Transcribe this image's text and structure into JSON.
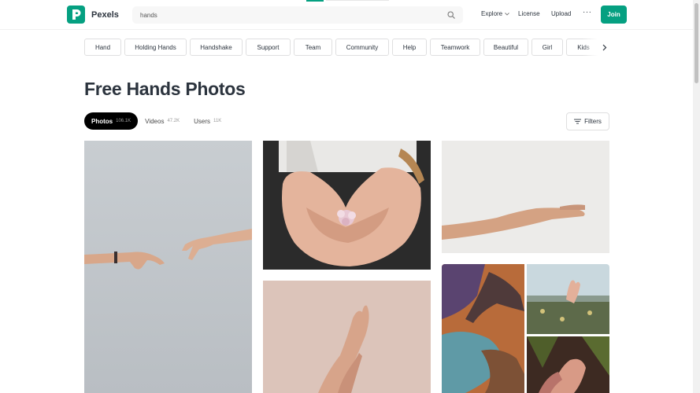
{
  "header": {
    "brand": "Pexels",
    "search_value": "hands",
    "nav": {
      "explore": "Explore",
      "license": "License",
      "upload": "Upload",
      "more": "···"
    },
    "join": "Join",
    "accent": "#05a081"
  },
  "related": [
    "Hand",
    "Holding Hands",
    "Handshake",
    "Support",
    "Team",
    "Community",
    "Help",
    "Teamwork",
    "Beautiful",
    "Girl",
    "Kids"
  ],
  "page": {
    "title": "Free Hands Photos"
  },
  "tabs": [
    {
      "label": "Photos",
      "count": "106.1K",
      "active": true
    },
    {
      "label": "Videos",
      "count": "47.2K",
      "active": false
    },
    {
      "label": "Users",
      "count": "11K",
      "active": false
    }
  ],
  "filters": {
    "label": "Filters"
  },
  "icons": {
    "search": "search-icon",
    "chevron_down": "chevron-down-icon",
    "chevron_right": "chevron-right-icon",
    "filters": "filters-icon"
  },
  "photos": [
    "hands-reaching-grey-photo",
    "cupped-hands-flower-photo",
    "open-hand-white-photo",
    "raised-hands-pink-photo",
    "painted-hands-photo",
    "hand-field-photo",
    "hands-leaves-photo"
  ]
}
